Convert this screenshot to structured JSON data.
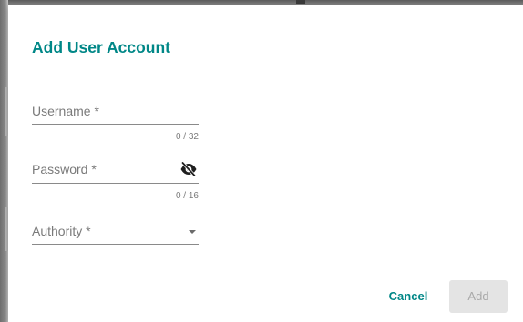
{
  "dialog": {
    "title": "Add User Account",
    "username": {
      "label": "Username *",
      "value": "",
      "counter": "0 / 32",
      "max_length": 32
    },
    "password": {
      "label": "Password *",
      "value": "",
      "counter": "0 / 16",
      "max_length": 16,
      "visibility_icon": "visibility-off-icon"
    },
    "authority": {
      "label": "Authority *",
      "selected": "",
      "dropdown_icon": "arrow-drop-down-icon"
    },
    "actions": {
      "cancel_label": "Cancel",
      "add_label": "Add",
      "add_enabled": false
    }
  },
  "colors": {
    "accent": "#008787",
    "label_gray": "#7a7a7a",
    "disabled_bg": "#e4e4e4",
    "disabled_text": "#a9a9a9"
  }
}
